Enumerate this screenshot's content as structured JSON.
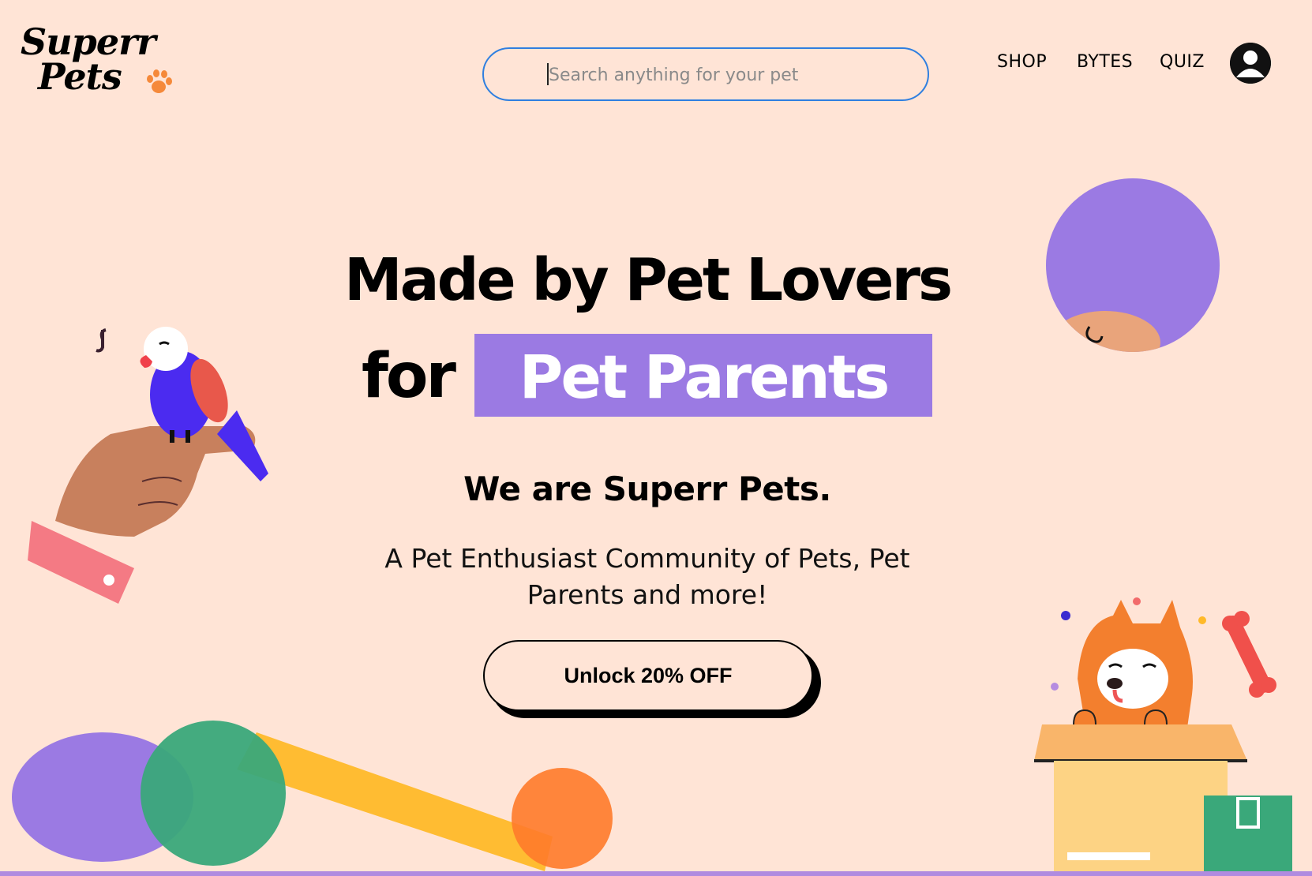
{
  "brand": {
    "line1": "Superr",
    "line2": "Pets"
  },
  "search": {
    "placeholder": "Search anything for your pet"
  },
  "nav": {
    "items": [
      {
        "label": "SHOP"
      },
      {
        "label": "BYTES"
      },
      {
        "label": "QUIZ"
      }
    ]
  },
  "hero": {
    "headline_line1": "Made by Pet Lovers",
    "headline_for": "for",
    "headline_highlight": "Pet Parents",
    "subheadline": "We are Superr Pets.",
    "description": "A Pet Enthusiast Community of Pets, Pet Parents and more!",
    "cta_label": "Unlock 20% OFF"
  },
  "colors": {
    "background": "#ffe4d6",
    "accent_purple": "#9b7ae3",
    "search_border": "#2f7fe0",
    "paw": "#f5893a"
  },
  "icons": {
    "profile": "user-circle-icon",
    "paw": "paw-icon"
  }
}
